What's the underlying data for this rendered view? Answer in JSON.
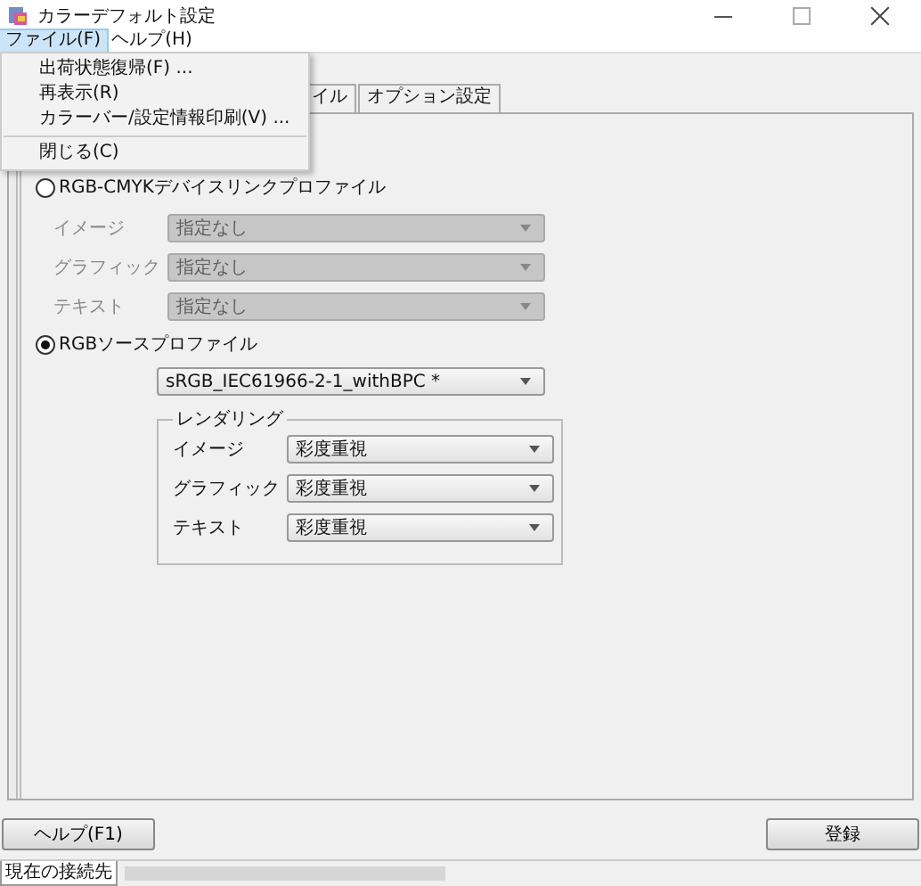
{
  "window": {
    "title": "カラーデフォルト設定"
  },
  "menu_bar": [
    {
      "label": "ファイル(F)",
      "selected": true
    },
    {
      "label": "ヘルプ(H)",
      "selected": false
    }
  ],
  "menu": {
    "items": [
      {
        "kind": "item",
        "label": "出荷状態復帰(F) ..."
      },
      {
        "kind": "item",
        "label": "再表示(R)"
      },
      {
        "kind": "item",
        "label": "カラーバー/設定情報印刷(V) ..."
      },
      {
        "kind": "separator"
      },
      {
        "kind": "item",
        "label": "閉じる(C)"
      }
    ]
  },
  "tabs": [
    {
      "label": "イル",
      "selected": false
    },
    {
      "label": "オプション設定",
      "selected": false
    }
  ],
  "devicelink": {
    "label": "RGB-CMYKデバイスリンクプロファイル",
    "selected": false,
    "rows": [
      {
        "label": "イメージ",
        "value": "指定なし",
        "disabled": true
      },
      {
        "label": "グラフィック",
        "value": "指定なし",
        "disabled": true
      },
      {
        "label": "テキスト",
        "value": "指定なし",
        "disabled": true
      }
    ]
  },
  "source": {
    "label": "RGBソースプロファイル",
    "selected": true,
    "profile": {
      "value": "sRGB_IEC61966-2-1_withBPC  *",
      "disabled": false
    },
    "rendering": {
      "title": "レンダリング",
      "rows": [
        {
          "label": "イメージ",
          "value": "彩度重視",
          "disabled": false
        },
        {
          "label": "グラフィック",
          "value": "彩度重視",
          "disabled": false
        },
        {
          "label": "テキスト",
          "value": "彩度重視",
          "disabled": false
        }
      ]
    }
  },
  "help_button": {
    "label": "ヘルプ(F1)"
  },
  "register_button": {
    "label": "登録"
  },
  "status_bar": {
    "label": "現在の接続先"
  }
}
